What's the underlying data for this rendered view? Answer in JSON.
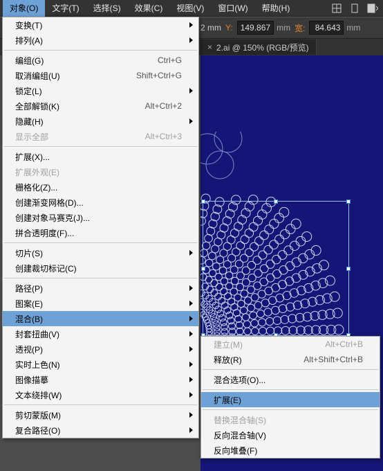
{
  "menubar": {
    "items": [
      "对象(O)",
      "文字(T)",
      "选择(S)",
      "效果(C)",
      "视图(V)",
      "窗口(W)",
      "帮助(H)"
    ]
  },
  "options": {
    "x_suffix": "2 mm",
    "y_label": "Y:",
    "y_value": "149.867",
    "y_unit": "mm",
    "w_label": "宽:",
    "w_value": "84.643",
    "w_unit": "mm"
  },
  "tab": {
    "title": "2.ai @ 150% (RGB/预览)",
    "close": "×"
  },
  "menu1": [
    {
      "t": "变换(T)",
      "sub": true
    },
    {
      "t": "排列(A)",
      "sub": true
    },
    {
      "sep": true
    },
    {
      "t": "编组(G)",
      "sc": "Ctrl+G"
    },
    {
      "t": "取消编组(U)",
      "sc": "Shift+Ctrl+G"
    },
    {
      "t": "锁定(L)",
      "sub": true
    },
    {
      "t": "全部解锁(K)",
      "sc": "Alt+Ctrl+2"
    },
    {
      "t": "隐藏(H)",
      "sub": true
    },
    {
      "t": "显示全部",
      "sc": "Alt+Ctrl+3",
      "dis": true
    },
    {
      "sep": true
    },
    {
      "t": "扩展(X)..."
    },
    {
      "t": "扩展外观(E)",
      "dis": true
    },
    {
      "t": "栅格化(Z)..."
    },
    {
      "t": "创建渐变网格(D)..."
    },
    {
      "t": "创建对象马赛克(J)..."
    },
    {
      "t": "拼合透明度(F)..."
    },
    {
      "sep": true
    },
    {
      "t": "切片(S)",
      "sub": true
    },
    {
      "t": "创建裁切标记(C)"
    },
    {
      "sep": true
    },
    {
      "t": "路径(P)",
      "sub": true
    },
    {
      "t": "图案(E)",
      "sub": true
    },
    {
      "t": "混合(B)",
      "sub": true,
      "hov": true
    },
    {
      "t": "封套扭曲(V)",
      "sub": true
    },
    {
      "t": "透视(P)",
      "sub": true
    },
    {
      "t": "实时上色(N)",
      "sub": true
    },
    {
      "t": "图像描摹",
      "sub": true
    },
    {
      "t": "文本绕排(W)",
      "sub": true
    },
    {
      "sep": true
    },
    {
      "t": "剪切蒙版(M)",
      "sub": true
    },
    {
      "t": "复合路径(O)",
      "sub": true
    }
  ],
  "menu2": [
    {
      "t": "建立(M)",
      "sc": "Alt+Ctrl+B",
      "dis": true
    },
    {
      "t": "释放(R)",
      "sc": "Alt+Shift+Ctrl+B"
    },
    {
      "sep": true
    },
    {
      "t": "混合选项(O)..."
    },
    {
      "sep": true
    },
    {
      "t": "扩展(E)",
      "hov": true
    },
    {
      "sep": true
    },
    {
      "t": "替换混合轴(S)",
      "dis": true
    },
    {
      "t": "反向混合轴(V)"
    },
    {
      "t": "反向堆叠(F)"
    }
  ]
}
